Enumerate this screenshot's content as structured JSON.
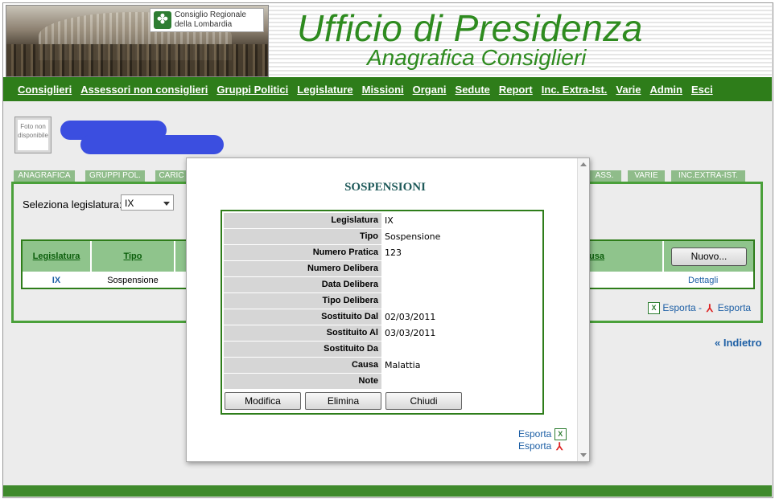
{
  "header": {
    "title": "Ufficio di Presidenza",
    "subtitle": "Anagrafica Consiglieri",
    "logo_line1": "Consiglio Regionale",
    "logo_line2": "della Lombardia"
  },
  "menu": [
    "Consiglieri",
    "Assessori non consiglieri",
    "Gruppi Politici",
    "Legislature",
    "Missioni",
    "Organi",
    "Sedute",
    "Report",
    "Inc. Extra-Ist.",
    "Varie",
    "Admin",
    "Esci"
  ],
  "profile": {
    "foto_text": "Foto non disponibile"
  },
  "tabs": [
    "ANAGRAFICA",
    "GRUPPI POL.",
    "CARIC",
    "ASS.",
    "VARIE",
    "INC.EXTRA-IST."
  ],
  "selector": {
    "label": "Seleziona legislatura:",
    "value": "IX"
  },
  "grid": {
    "headers": [
      "Legislatura",
      "Tipo",
      "usa"
    ],
    "row": [
      "IX",
      "Sospensione"
    ],
    "new_button": "Nuovo...",
    "details_link": "Dettagli"
  },
  "export": {
    "label1": "Esporta",
    "separator": "-",
    "label2": "Esporta"
  },
  "back_link": "« Indietro",
  "modal": {
    "title": "SOSPENSIONI",
    "fields": [
      {
        "label": "Legislatura",
        "value": "IX"
      },
      {
        "label": "Tipo",
        "value": "Sospensione"
      },
      {
        "label": "Numero Pratica",
        "value": "123"
      },
      {
        "label": "Numero Delibera",
        "value": ""
      },
      {
        "label": "Data Delibera",
        "value": ""
      },
      {
        "label": "Tipo Delibera",
        "value": ""
      },
      {
        "label": "Sostituito Dal",
        "value": "02/03/2011"
      },
      {
        "label": "Sostituito Al",
        "value": "03/03/2011"
      },
      {
        "label": "Sostituito Da",
        "value": ""
      },
      {
        "label": "Causa",
        "value": "Malattia"
      },
      {
        "label": "Note",
        "value": ""
      }
    ],
    "buttons": {
      "modifica": "Modifica",
      "elimina": "Elimina",
      "chiudi": "Chiudi"
    },
    "export1": "Esporta",
    "export2": "Esporta"
  },
  "colors": {
    "brand_green": "#2e7d1a",
    "link_blue": "#1d5fa5",
    "redaction_blue": "#3b4ee0"
  }
}
